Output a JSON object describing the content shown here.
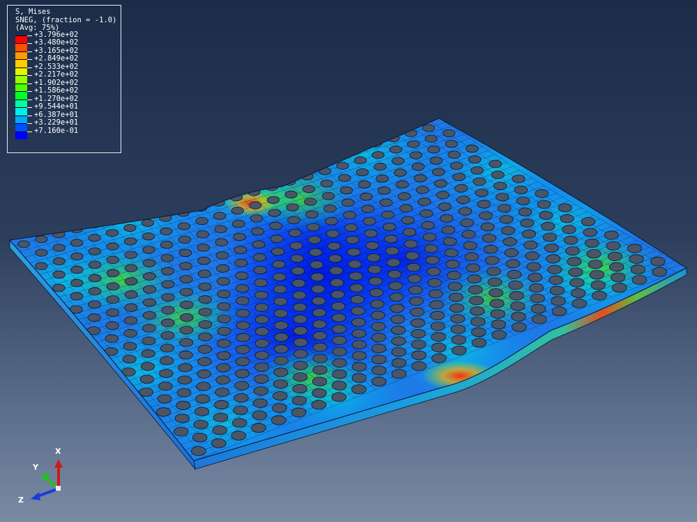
{
  "legend": {
    "variable": "S, Mises",
    "section": "SNEG, (fraction = -1.0)",
    "averaging": "(Avg: 75%)",
    "entries": [
      {
        "label": "+3.796e+02",
        "color": "#ff0000"
      },
      {
        "label": "+3.480e+02",
        "color": "#ff4f00"
      },
      {
        "label": "+3.165e+02",
        "color": "#ff9a00"
      },
      {
        "label": "+2.849e+02",
        "color": "#ffcc00"
      },
      {
        "label": "+2.533e+02",
        "color": "#e2f400"
      },
      {
        "label": "+2.217e+02",
        "color": "#99ff00"
      },
      {
        "label": "+1.902e+02",
        "color": "#4cff00"
      },
      {
        "label": "+1.586e+02",
        "color": "#00ff2c"
      },
      {
        "label": "+1.270e+02",
        "color": "#00ffa4"
      },
      {
        "label": "+9.544e+01",
        "color": "#00f0e8"
      },
      {
        "label": "+6.387e+01",
        "color": "#00a8ff"
      },
      {
        "label": "+3.229e+01",
        "color": "#0050ff"
      },
      {
        "label": "+7.160e-01",
        "color": "#0000ff"
      }
    ]
  },
  "triad": {
    "x_label": "X",
    "y_label": "Y",
    "z_label": "Z",
    "x_color": "#d01818",
    "y_color": "#22c022",
    "z_color": "#1c3cd8"
  },
  "model": {
    "hole_color": "#4a5566",
    "mesh_line_color": "#0a1530"
  }
}
